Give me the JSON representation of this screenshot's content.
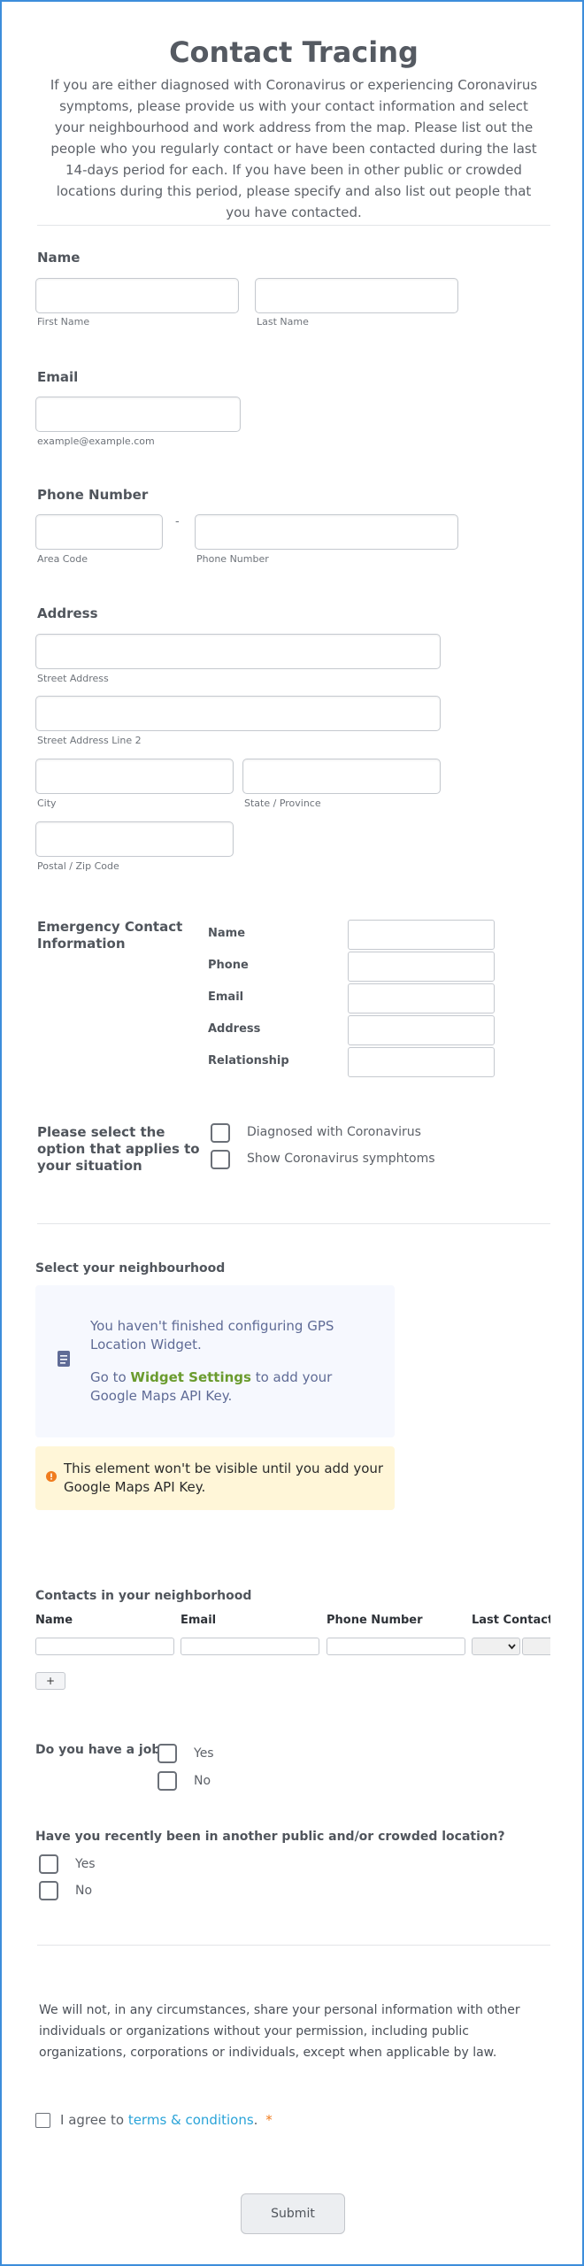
{
  "header": {
    "title": "Contact Tracing",
    "intro": "If you are either diagnosed with Coronavirus or experiencing Coronavirus symptoms, please provide us with your contact information and select your neighbourhood and work address from the map. Please list out the people who you regularly contact or have been contacted during the last 14-days period for each. If you have been in other public or crowded locations during this period, please specify and also list out people that you have contacted."
  },
  "name": {
    "label": "Name",
    "first": "First Name",
    "last": "Last Name"
  },
  "email": {
    "label": "Email",
    "hint": "example@example.com"
  },
  "phone": {
    "label": "Phone Number",
    "dash": "-",
    "area": "Area Code",
    "number": "Phone Number"
  },
  "address": {
    "label": "Address",
    "street": "Street Address",
    "street2": "Street Address Line 2",
    "city": "City",
    "state": "State / Province",
    "postal": "Postal / Zip Code"
  },
  "emergency": {
    "label": "Emergency Contact Information",
    "fields": [
      "Name",
      "Phone",
      "Email",
      "Address",
      "Relationship"
    ]
  },
  "situation": {
    "label": "Please select the option that applies to your situation",
    "options": [
      "Diagnosed with Coronavirus",
      "Show Coronavirus symphtoms"
    ]
  },
  "neighbourhood": {
    "label": "Select your neighbourhood",
    "widget_msg": "You haven't finished configuring GPS Location Widget.",
    "go_to": "Go to",
    "widget_link": "Widget Settings",
    "add_key": "to add your Google Maps API Key.",
    "warning": "This element won't be visible until you add your Google Maps API Key."
  },
  "contacts": {
    "label": "Contacts in your neighborhood",
    "columns": [
      "Name",
      "Email",
      "Phone Number",
      "Last Contact Date"
    ],
    "add_button": "+"
  },
  "job": {
    "label": "Do you have a job?",
    "options": [
      "Yes",
      "No"
    ]
  },
  "crowded": {
    "label": "Have you recently been in another public and/or crowded location?",
    "options": [
      "Yes",
      "No"
    ]
  },
  "privacy": "We will not, in any circumstances, share your personal information with other individuals or organizations without your permission, including public organizations, corporations or individuals, except when applicable by law.",
  "terms": {
    "prefix": "I agree to",
    "link": "terms & conditions",
    "suffix": ".",
    "required": "*"
  },
  "submit": "Submit",
  "colors": {
    "accent": "#3c8ddb",
    "link": "#2aa3d8",
    "required": "#f07c1e",
    "widget_link": "#6a9b2e"
  }
}
